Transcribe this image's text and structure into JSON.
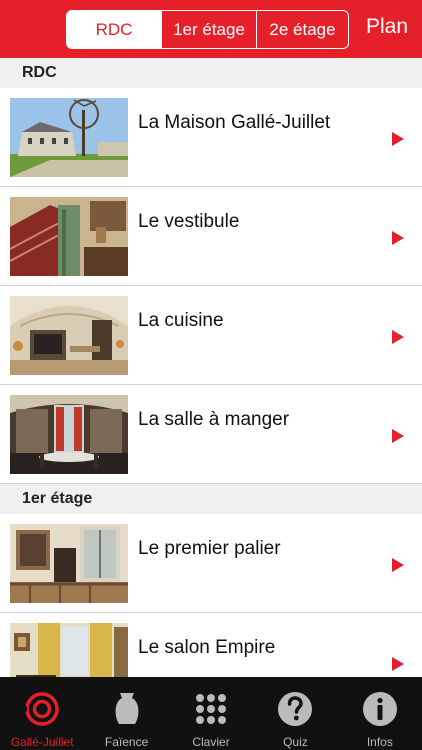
{
  "header": {
    "segments": [
      {
        "label": "RDC"
      },
      {
        "label": "1er étage"
      },
      {
        "label": "2e étage"
      }
    ],
    "plan_label": "Plan",
    "accent": "#e6202a"
  },
  "sections": [
    {
      "title": "RDC",
      "items": [
        {
          "title": "La Maison Gallé-Juillet"
        },
        {
          "title": "Le vestibule"
        },
        {
          "title": "La cuisine"
        },
        {
          "title": "La salle à manger"
        }
      ]
    },
    {
      "title": "1er étage",
      "items": [
        {
          "title": "Le premier palier"
        },
        {
          "title": "Le salon Empire"
        }
      ]
    }
  ],
  "tabs": [
    {
      "label": "Gallé-Juillet",
      "icon": "target-icon",
      "active": true
    },
    {
      "label": "Faïence",
      "icon": "vase-icon"
    },
    {
      "label": "Clavier",
      "icon": "keypad-icon"
    },
    {
      "label": "Quiz",
      "icon": "question-icon"
    },
    {
      "label": "Infos",
      "icon": "info-icon"
    }
  ]
}
